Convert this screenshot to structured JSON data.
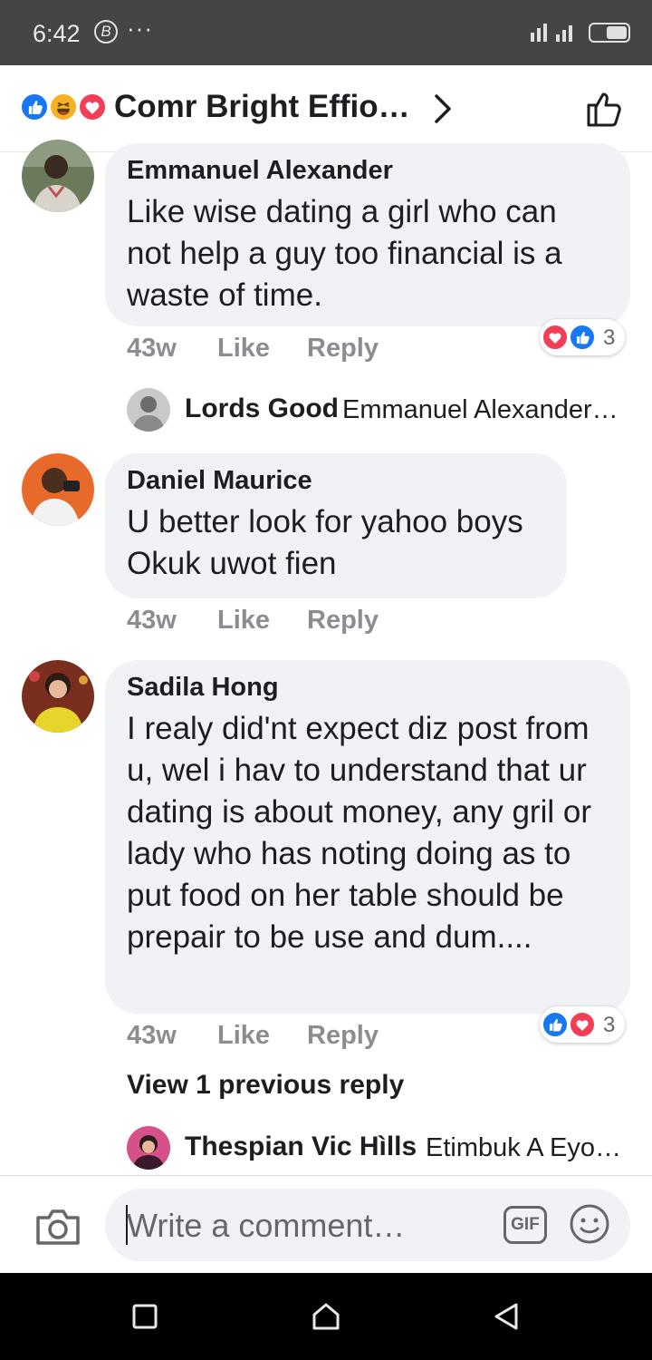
{
  "status_bar": {
    "time": "6:42",
    "b_icon": "B",
    "more": "···"
  },
  "header": {
    "title": "Comr Bright Effio…",
    "reaction_icons": [
      "like-icon",
      "haha-icon",
      "love-icon"
    ],
    "colors": {
      "like": "#1877f2",
      "love": "#f33e58",
      "haha": "#f7b125"
    }
  },
  "comments": [
    {
      "author": "Emmanuel Alexander",
      "text": "Like wise dating a girl who can not help a guy too financial is a waste of time.",
      "time": "43w",
      "like_label": "Like",
      "reply_label": "Reply",
      "reaction_count": "3",
      "reply_preview": {
        "author": "Lords Good",
        "text": "Emmanuel Alexander…"
      }
    },
    {
      "author": "Daniel Maurice",
      "text": "U better look for yahoo boys Okuk uwot fien",
      "time": "43w",
      "like_label": "Like",
      "reply_label": "Reply"
    },
    {
      "author": "Sadila Hong",
      "text": "I realy did'nt expect diz post from u, wel i hav to understand that ur dating is about money, any gril or lady who has noting doing as to put food on her table should be prepair to be use and dum....",
      "time": "43w",
      "like_label": "Like",
      "reply_label": "Reply",
      "reaction_count": "3",
      "view_previous": "View 1 previous reply",
      "reply_preview": {
        "author": "Thespian Vic Hìlls",
        "text": "Etimbuk A Eyo…"
      }
    }
  ],
  "composer": {
    "placeholder": "Write a comment…",
    "gif_label": "GIF"
  }
}
